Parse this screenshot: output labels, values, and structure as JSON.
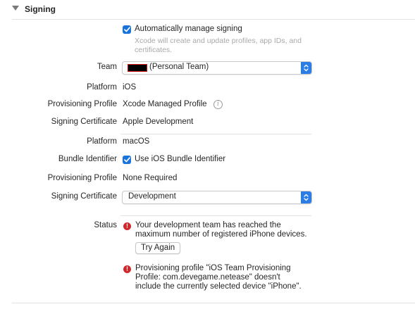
{
  "section": {
    "title": "Signing"
  },
  "auto_signing": {
    "label": "Automatically manage signing",
    "subtext_line1": "Xcode will create and update profiles, app IDs, and",
    "subtext_line2": "certificates.",
    "checked": true
  },
  "team": {
    "label": "Team",
    "value": "(Personal Team)"
  },
  "ios": {
    "platform_label": "Platform",
    "platform_value": "iOS",
    "prov_label": "Provisioning Profile",
    "prov_value": "Xcode Managed Profile",
    "cert_label": "Signing Certificate",
    "cert_value": "Apple Development"
  },
  "macos": {
    "platform_label": "Platform",
    "platform_value": "macOS",
    "bundle_label": "Bundle Identifier",
    "bundle_value": "Use iOS Bundle Identifier",
    "prov_label": "Provisioning Profile",
    "prov_value": "None Required",
    "cert_label": "Signing Certificate",
    "cert_value": "Development"
  },
  "status": {
    "label": "Status",
    "error1_line1": "Your development team has reached the",
    "error1_line2": "maximum number of registered iPhone devices.",
    "retry_label": "Try Again",
    "error2_line1": "Provisioning profile \"iOS Team Provisioning",
    "error2_line2": "Profile: com.devegame.netease\" doesn't",
    "error2_line3": "include the currently selected device \"iPhone\"."
  },
  "icons": {
    "disclosure": "disclosure-triangle-icon",
    "checkbox": "checkmark-icon",
    "info": "info-icon",
    "error": "error-icon",
    "stepper": "chevron-updown-icon"
  },
  "colors": {
    "accent": "#2a7ce6",
    "error": "#d0262c",
    "subtext": "#a9a9a9"
  }
}
